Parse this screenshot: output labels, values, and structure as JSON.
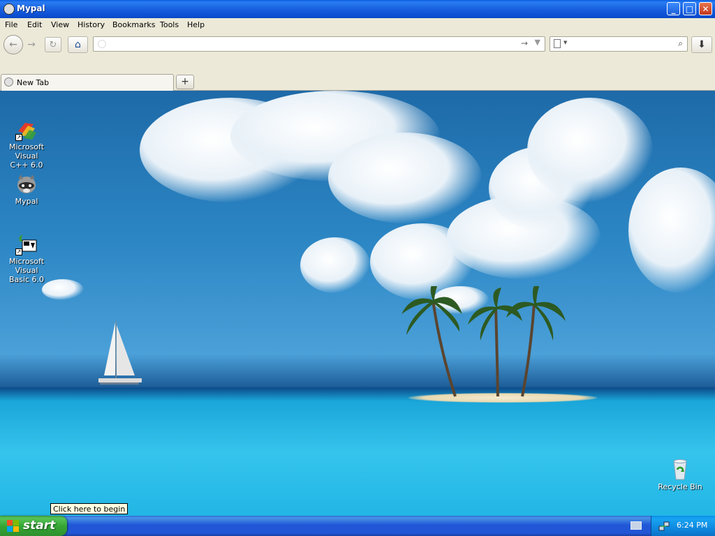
{
  "window": {
    "title": "Mypal",
    "buttons": {
      "minimize": "_",
      "maximize": "□",
      "close": "✕"
    }
  },
  "menu": [
    "File",
    "Edit",
    "View",
    "History",
    "Bookmarks",
    "Tools",
    "Help"
  ],
  "navbar": {
    "url_value": "",
    "url_placeholder": "",
    "search_value": "",
    "search_placeholder": ""
  },
  "tabs": [
    {
      "label": "New Tab"
    }
  ],
  "desktop_icons": [
    {
      "name": "microsoft-visual-cpp",
      "label_line1": "Microsoft Visual",
      "label_line2": "C++ 6.0"
    },
    {
      "name": "mypal",
      "label_line1": "Mypal",
      "label_line2": ""
    },
    {
      "name": "microsoft-visual-basic",
      "label_line1": "Microsoft Visual",
      "label_line2": "Basic 6.0"
    },
    {
      "name": "recycle-bin",
      "label_line1": "Recycle Bin",
      "label_line2": ""
    }
  ],
  "tooltip": "Click here to begin",
  "taskbar": {
    "start_label": "start",
    "clock": "6:24 PM"
  },
  "colors": {
    "title_bar": "#0b4dd0",
    "chrome": "#ece9d8",
    "taskbar": "#2157d7",
    "start_button": "#35a735",
    "tray": "#0f8ae0"
  }
}
